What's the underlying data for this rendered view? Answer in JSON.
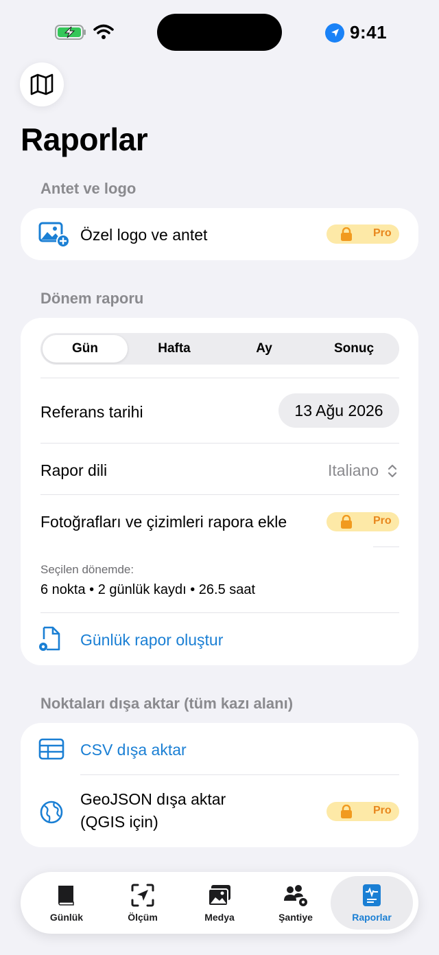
{
  "status_bar": {
    "time": "9:41"
  },
  "page": {
    "title": "Raporlar"
  },
  "sections": {
    "letterhead": {
      "header": "Antet ve logo",
      "row_label": "Özel logo ve antet",
      "badge": "Pro"
    },
    "period_report": {
      "header": "Dönem raporu",
      "segments": [
        "Gün",
        "Hafta",
        "Ay",
        "Sonuç"
      ],
      "selected_segment": "Gün",
      "reference_date_label": "Referans tarihi",
      "reference_date_value": "13 Ağu 2026",
      "language_label": "Rapor dili",
      "language_value": "Italiano",
      "photos_label": "Fotoğrafları ve çizimleri rapora ekle",
      "photos_badge": "Pro",
      "summary_caption": "Seçilen dönemde:",
      "summary_text": "6 nokta • 2 günlük kaydı • 26.5 saat",
      "action_label": "Günlük rapor oluştur"
    },
    "export": {
      "header": "Noktaları dışa aktar (tüm kazı alanı)",
      "csv_label": "CSV dışa aktar",
      "geojson_line1": "GeoJSON dışa aktar",
      "geojson_line2": "(QGIS için)",
      "geojson_badge": "Pro"
    }
  },
  "tabbar": {
    "items": [
      {
        "label": "Günlük",
        "icon": "book-icon"
      },
      {
        "label": "Ölçüm",
        "icon": "location-scan-icon"
      },
      {
        "label": "Medya",
        "icon": "photos-icon"
      },
      {
        "label": "Şantiye",
        "icon": "team-gear-icon"
      },
      {
        "label": "Raporlar",
        "icon": "report-icon"
      }
    ],
    "active": "Raporlar"
  },
  "colors": {
    "accent": "#1a7fd4",
    "background": "#f2f2f7",
    "pro_badge_bg": "#fde9a7",
    "pro_badge_fg": "#e8871e"
  }
}
